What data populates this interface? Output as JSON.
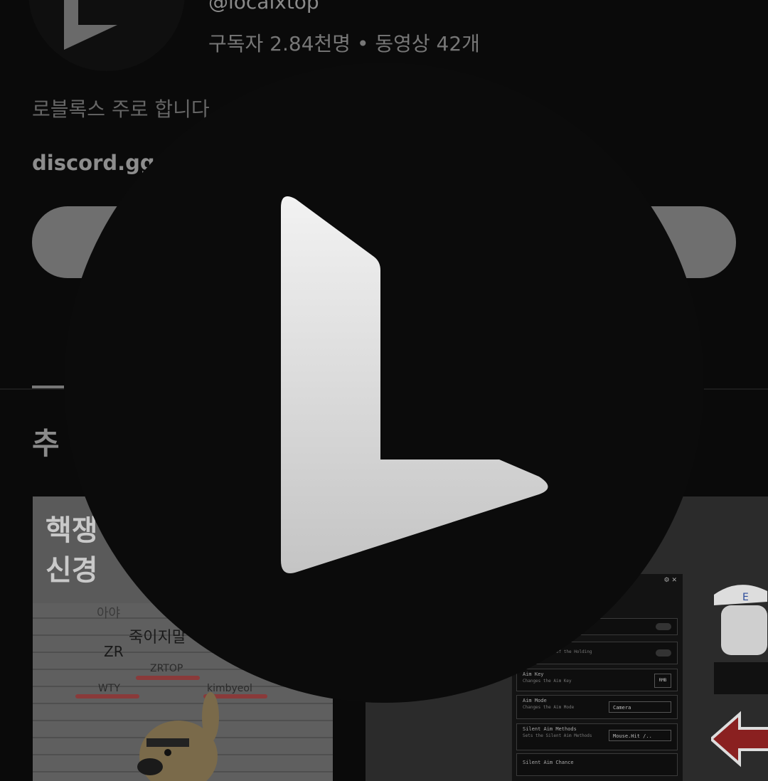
{
  "channel": {
    "handle": "@localxtop",
    "stats": "구독자 2.84천명 • 동영상 42개",
    "description": "로블록스 주로 합니다",
    "link": "discord.gg/"
  },
  "section": {
    "title": "추"
  },
  "thumbnail_1": {
    "title_line1": "핵쟁",
    "title_line2": "신경",
    "labels": [
      "아야",
      "죽이지말",
      "ZR",
      "ZRTOP",
      "WTY",
      "kimbyeol"
    ]
  },
  "thumbnail_2": {
    "panel_rows": [
      {
        "title": "",
        "sub": "",
        "control": "toggle"
      },
      {
        "title": "",
        "sub": "Mode instead of the Holding",
        "control": "toggle"
      },
      {
        "title": "Aim Key",
        "sub": "Changes the Aim Key",
        "control": "key",
        "value": "RMB"
      },
      {
        "title": "Aim Mode",
        "sub": "Changes the Aim Mode",
        "control": "select",
        "value": "Camera"
      },
      {
        "title": "Silent Aim Methods",
        "sub": "Sets the Silent Aim Methods",
        "control": "select",
        "value": "Mouse.Hit /.."
      },
      {
        "title": "Silent Aim Chance",
        "sub": "",
        "control": "none"
      }
    ]
  },
  "overlay": {
    "logo": "L-logo-icon"
  },
  "colors": {
    "background": "#0a0a0a",
    "overlay": "#0b0b0b",
    "button": "#6f6f6f"
  }
}
